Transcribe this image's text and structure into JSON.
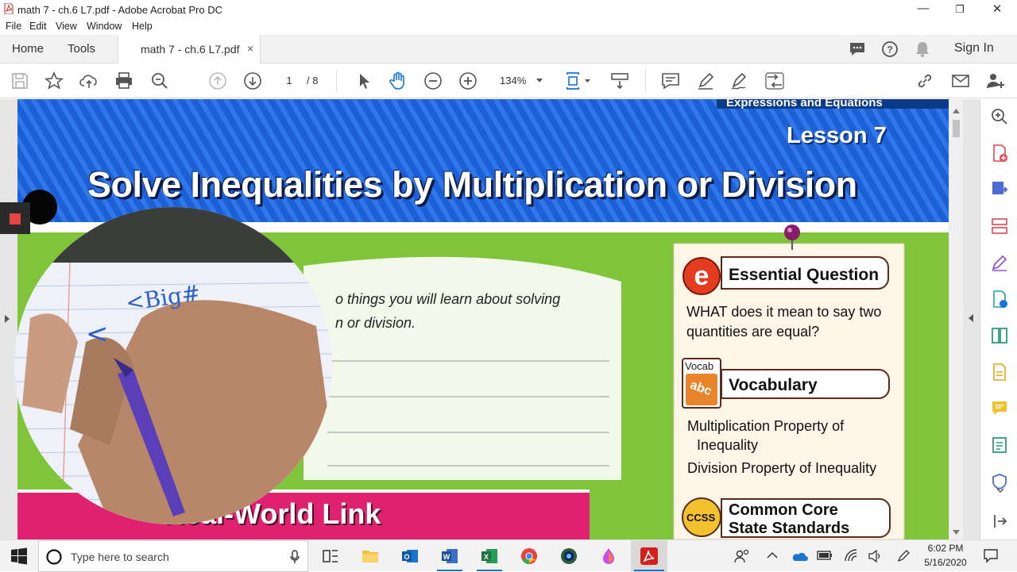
{
  "window": {
    "title": "math 7 - ch.6 L7.pdf - Adobe Acrobat Pro DC",
    "minimize": "—",
    "restore": "❐",
    "close": "✕"
  },
  "menu": [
    "File",
    "Edit",
    "View",
    "Window",
    "Help"
  ],
  "tabs": {
    "home": "Home",
    "tools": "Tools",
    "document": "math 7 - ch.6 L7.pdf",
    "close": "×",
    "sign_in": "Sign In"
  },
  "toolbar": {
    "page_current": "1",
    "page_total": "/ 8",
    "zoom": "134%"
  },
  "document": {
    "header_strip": "Expressions and Equations",
    "lesson": "Lesson 7",
    "title": "Solve Inequalities by Multiplication or Division",
    "intro_line1": "o things you will learn about solving",
    "intro_line2": "n or division.",
    "eq_heading": "Essential Question",
    "eq_text_line1": "WHAT does it mean to say two",
    "eq_text_line2": "quantities are equal?",
    "vocab_badge": "Vocab",
    "vocab_abc": "abc",
    "vocab_heading": "Vocabulary",
    "vocab_item1_line1": "Multiplication Property of",
    "vocab_item1_line2": "Inequality",
    "vocab_item2": "Division Property of Inequality",
    "ccss_badge": "CCSS",
    "ccss_heading_line1": "Common Core",
    "ccss_heading_line2": "State Standards",
    "banner": "Real-World Link",
    "webcam_note1": "<Big#",
    "webcam_note2": "<"
  },
  "taskbar": {
    "search_placeholder": "Type here to search",
    "time": "6:02 PM",
    "date": "5/16/2020"
  },
  "colors": {
    "acrobat_red": "#d4201a",
    "header_blue": "#1d5fd6",
    "page_green": "#7fc43a",
    "banner_magenta": "#e0216f",
    "panel_bg": "#fdf6e8"
  }
}
